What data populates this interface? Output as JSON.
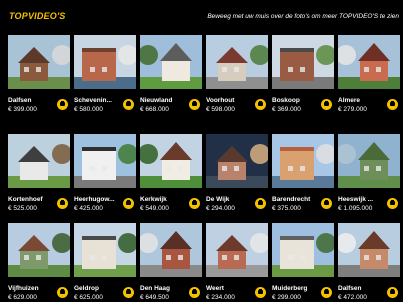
{
  "header": {
    "title": "TOPVIDEO'S",
    "hint": "Beweeg met uw muis over de foto's om meer TOPVIDEO'S te zien"
  },
  "listings": [
    {
      "name": "Dalfsen",
      "price": "€ 399.000"
    },
    {
      "name": "Schevenin...",
      "price": "€ 580.000"
    },
    {
      "name": "Nieuwland",
      "price": "€ 668.000"
    },
    {
      "name": "Voorhout",
      "price": "€ 598.000"
    },
    {
      "name": "Boskoop",
      "price": "€ 369.000"
    },
    {
      "name": "Almere",
      "price": "€ 279.000"
    },
    {
      "name": "Kortenhoef",
      "price": "€ 525.000"
    },
    {
      "name": "Heerhugow...",
      "price": "€ 425.000"
    },
    {
      "name": "Kerkwijk",
      "price": "€ 549.000"
    },
    {
      "name": "De Wijk",
      "price": "€ 294.000"
    },
    {
      "name": "Barendrecht",
      "price": "€ 375.000"
    },
    {
      "name": "Heeswijk ...",
      "price": "€ 1.095.000"
    },
    {
      "name": "Vijfhuizen",
      "price": "€ 629.000"
    },
    {
      "name": "Geldrop",
      "price": "€ 625.000"
    },
    {
      "name": "Den Haag",
      "price": "€ 649.500"
    },
    {
      "name": "Weert",
      "price": "€ 234.000"
    },
    {
      "name": "Muiderberg",
      "price": "€ 299.000"
    },
    {
      "name": "Dalfsen",
      "price": "€ 472.000"
    }
  ],
  "colors": {
    "accent": "#f2c200",
    "background": "#000000"
  },
  "icons": {
    "favorite": "save-icon"
  }
}
